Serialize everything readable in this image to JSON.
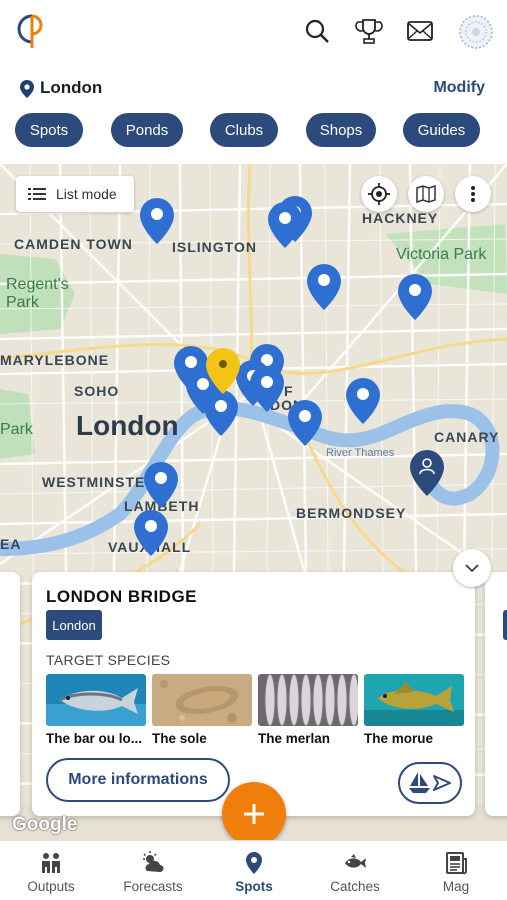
{
  "header": {
    "logo_icon": "cp-logo-icon",
    "icons": [
      "search-icon",
      "trophy-icon",
      "mail-icon",
      "avatar"
    ]
  },
  "location": {
    "city": "London",
    "modify_label": "Modify"
  },
  "filters": [
    "Spots",
    "Ponds",
    "Clubs",
    "Shops",
    "Guides"
  ],
  "map": {
    "list_mode_label": "List mode",
    "labels": {
      "hackney": "HACKNEY",
      "camden": "CAMDEN TOWN",
      "islington": "ISLINGTON",
      "victoria_park": "Victoria Park",
      "regents_1": "Regent's",
      "regents_2": "Park",
      "marylebone": "MARYLEBONE",
      "soho": "SOHO",
      "london": "London",
      "park": "Park",
      "canary": "CANARY",
      "westminster": "WESTMINSTE",
      "lambeth": "LAMBETH",
      "bermondsey": "BERMONDSEY",
      "vauxhall": "VAUXHALL",
      "river": "River Thames",
      "ea": "EA",
      "of": "F",
      "don": "DON"
    },
    "attribution": "Google"
  },
  "card": {
    "title": "LONDON BRIDGE",
    "badge": "London",
    "target_label": "TARGET SPECIES",
    "species": [
      {
        "name": "The bar ou lo...",
        "image": "sea-bass"
      },
      {
        "name": "The sole",
        "image": "sole"
      },
      {
        "name": "The merlan",
        "image": "whiting"
      },
      {
        "name": "The morue",
        "image": "cod"
      }
    ],
    "more_label": "More informations"
  },
  "nav": [
    {
      "label": "Outputs",
      "icon": "people-icon"
    },
    {
      "label": "Forecasts",
      "icon": "weather-icon"
    },
    {
      "label": "Spots",
      "icon": "location-pin-icon",
      "active": true
    },
    {
      "label": "Catches",
      "icon": "fish-icon"
    },
    {
      "label": "Mag",
      "icon": "newspaper-icon"
    }
  ],
  "colors": {
    "primary": "#2c4a7c",
    "accent": "#f07e0c",
    "pin_blue": "#2f6fd1",
    "pin_yellow": "#f2c416"
  }
}
